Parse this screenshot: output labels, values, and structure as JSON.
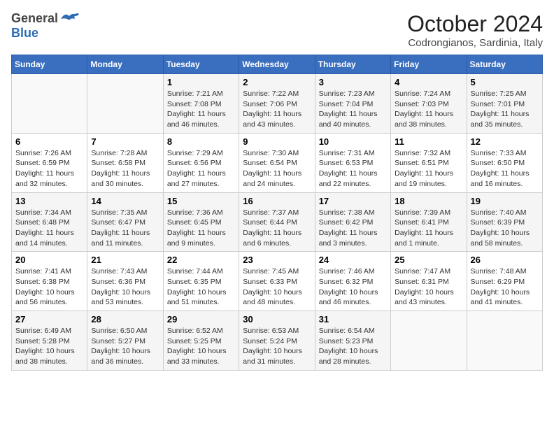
{
  "header": {
    "logo_general": "General",
    "logo_blue": "Blue",
    "month_title": "October 2024",
    "subtitle": "Codrongianos, Sardinia, Italy"
  },
  "days_of_week": [
    "Sunday",
    "Monday",
    "Tuesday",
    "Wednesday",
    "Thursday",
    "Friday",
    "Saturday"
  ],
  "weeks": [
    [
      {
        "day": "",
        "info": ""
      },
      {
        "day": "",
        "info": ""
      },
      {
        "day": "1",
        "info": "Sunrise: 7:21 AM\nSunset: 7:08 PM\nDaylight: 11 hours and 46 minutes."
      },
      {
        "day": "2",
        "info": "Sunrise: 7:22 AM\nSunset: 7:06 PM\nDaylight: 11 hours and 43 minutes."
      },
      {
        "day": "3",
        "info": "Sunrise: 7:23 AM\nSunset: 7:04 PM\nDaylight: 11 hours and 40 minutes."
      },
      {
        "day": "4",
        "info": "Sunrise: 7:24 AM\nSunset: 7:03 PM\nDaylight: 11 hours and 38 minutes."
      },
      {
        "day": "5",
        "info": "Sunrise: 7:25 AM\nSunset: 7:01 PM\nDaylight: 11 hours and 35 minutes."
      }
    ],
    [
      {
        "day": "6",
        "info": "Sunrise: 7:26 AM\nSunset: 6:59 PM\nDaylight: 11 hours and 32 minutes."
      },
      {
        "day": "7",
        "info": "Sunrise: 7:28 AM\nSunset: 6:58 PM\nDaylight: 11 hours and 30 minutes."
      },
      {
        "day": "8",
        "info": "Sunrise: 7:29 AM\nSunset: 6:56 PM\nDaylight: 11 hours and 27 minutes."
      },
      {
        "day": "9",
        "info": "Sunrise: 7:30 AM\nSunset: 6:54 PM\nDaylight: 11 hours and 24 minutes."
      },
      {
        "day": "10",
        "info": "Sunrise: 7:31 AM\nSunset: 6:53 PM\nDaylight: 11 hours and 22 minutes."
      },
      {
        "day": "11",
        "info": "Sunrise: 7:32 AM\nSunset: 6:51 PM\nDaylight: 11 hours and 19 minutes."
      },
      {
        "day": "12",
        "info": "Sunrise: 7:33 AM\nSunset: 6:50 PM\nDaylight: 11 hours and 16 minutes."
      }
    ],
    [
      {
        "day": "13",
        "info": "Sunrise: 7:34 AM\nSunset: 6:48 PM\nDaylight: 11 hours and 14 minutes."
      },
      {
        "day": "14",
        "info": "Sunrise: 7:35 AM\nSunset: 6:47 PM\nDaylight: 11 hours and 11 minutes."
      },
      {
        "day": "15",
        "info": "Sunrise: 7:36 AM\nSunset: 6:45 PM\nDaylight: 11 hours and 9 minutes."
      },
      {
        "day": "16",
        "info": "Sunrise: 7:37 AM\nSunset: 6:44 PM\nDaylight: 11 hours and 6 minutes."
      },
      {
        "day": "17",
        "info": "Sunrise: 7:38 AM\nSunset: 6:42 PM\nDaylight: 11 hours and 3 minutes."
      },
      {
        "day": "18",
        "info": "Sunrise: 7:39 AM\nSunset: 6:41 PM\nDaylight: 11 hours and 1 minute."
      },
      {
        "day": "19",
        "info": "Sunrise: 7:40 AM\nSunset: 6:39 PM\nDaylight: 10 hours and 58 minutes."
      }
    ],
    [
      {
        "day": "20",
        "info": "Sunrise: 7:41 AM\nSunset: 6:38 PM\nDaylight: 10 hours and 56 minutes."
      },
      {
        "day": "21",
        "info": "Sunrise: 7:43 AM\nSunset: 6:36 PM\nDaylight: 10 hours and 53 minutes."
      },
      {
        "day": "22",
        "info": "Sunrise: 7:44 AM\nSunset: 6:35 PM\nDaylight: 10 hours and 51 minutes."
      },
      {
        "day": "23",
        "info": "Sunrise: 7:45 AM\nSunset: 6:33 PM\nDaylight: 10 hours and 48 minutes."
      },
      {
        "day": "24",
        "info": "Sunrise: 7:46 AM\nSunset: 6:32 PM\nDaylight: 10 hours and 46 minutes."
      },
      {
        "day": "25",
        "info": "Sunrise: 7:47 AM\nSunset: 6:31 PM\nDaylight: 10 hours and 43 minutes."
      },
      {
        "day": "26",
        "info": "Sunrise: 7:48 AM\nSunset: 6:29 PM\nDaylight: 10 hours and 41 minutes."
      }
    ],
    [
      {
        "day": "27",
        "info": "Sunrise: 6:49 AM\nSunset: 5:28 PM\nDaylight: 10 hours and 38 minutes."
      },
      {
        "day": "28",
        "info": "Sunrise: 6:50 AM\nSunset: 5:27 PM\nDaylight: 10 hours and 36 minutes."
      },
      {
        "day": "29",
        "info": "Sunrise: 6:52 AM\nSunset: 5:25 PM\nDaylight: 10 hours and 33 minutes."
      },
      {
        "day": "30",
        "info": "Sunrise: 6:53 AM\nSunset: 5:24 PM\nDaylight: 10 hours and 31 minutes."
      },
      {
        "day": "31",
        "info": "Sunrise: 6:54 AM\nSunset: 5:23 PM\nDaylight: 10 hours and 28 minutes."
      },
      {
        "day": "",
        "info": ""
      },
      {
        "day": "",
        "info": ""
      }
    ]
  ]
}
